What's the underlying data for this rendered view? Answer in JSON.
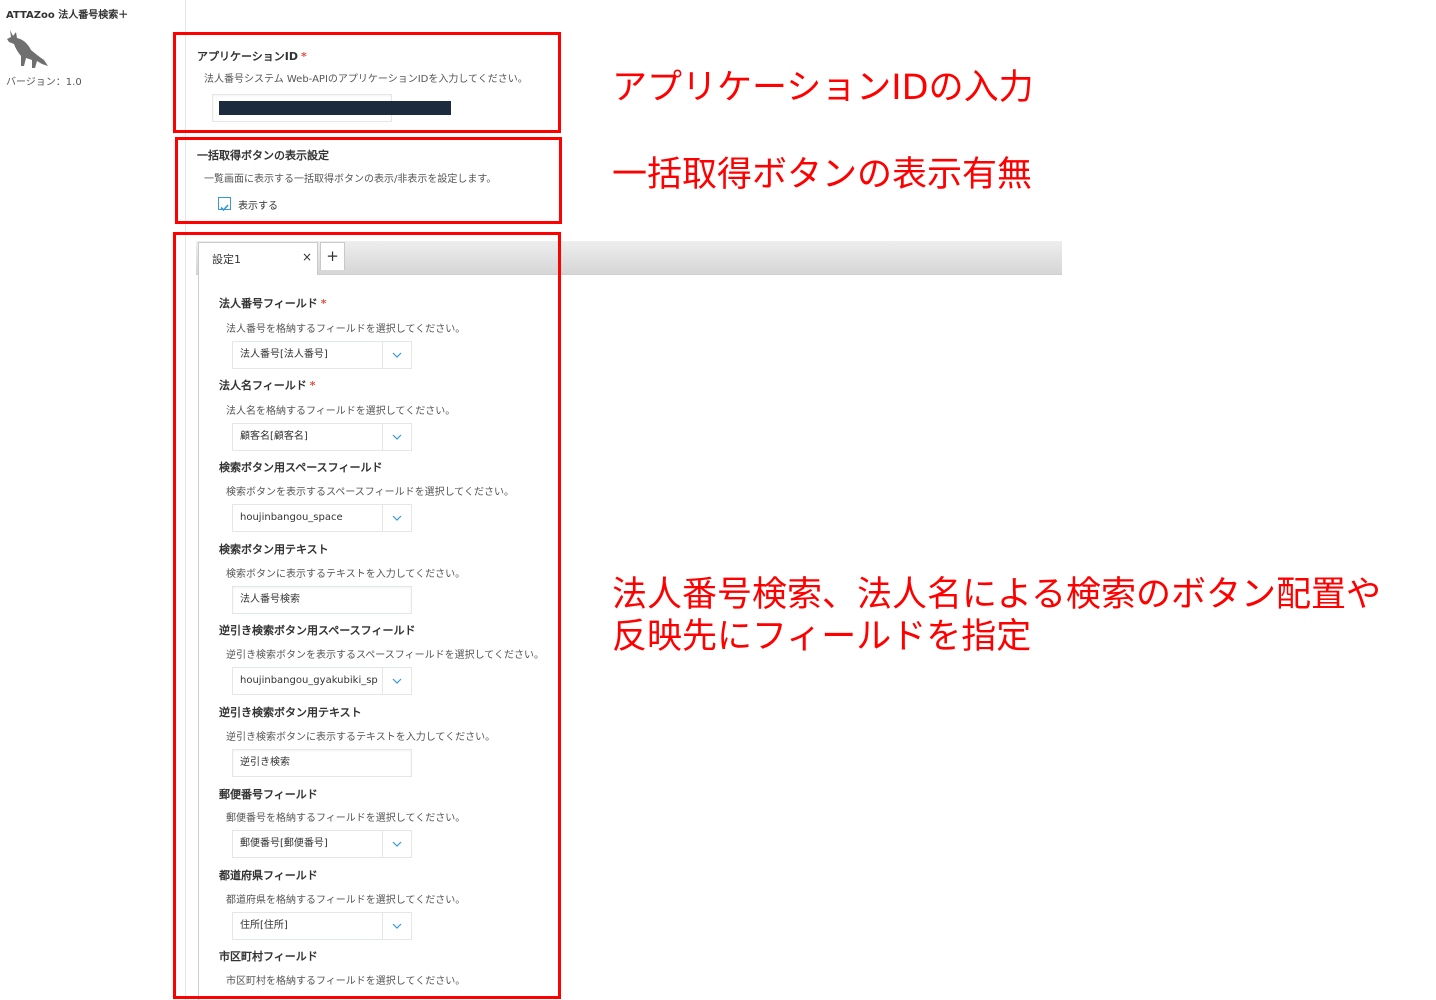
{
  "app": {
    "title": "ATTAZoo 法人番号検索＋",
    "version": "バージョン：1.0",
    "logo_icon": "wolf-icon"
  },
  "app_id": {
    "title": "アプリケーションID",
    "required_mark": "*",
    "desc": "法人番号システム Web-APIのアプリケーションIDを入力してください。",
    "value_redacted": true
  },
  "bulk": {
    "title": "一括取得ボタンの表示設定",
    "desc": "一覧画面に表示する一括取得ボタンの表示/非表示を設定します。",
    "checkbox_label": "表示する",
    "checked": true
  },
  "tabs": {
    "items": [
      {
        "label": "設定1",
        "close": "×"
      }
    ],
    "add": "+"
  },
  "settings": {
    "corp_number": {
      "title": "法人番号フィールド",
      "required_mark": "*",
      "desc": "法人番号を格納するフィールドを選択してください。",
      "value": "法人番号[法人番号]"
    },
    "corp_name": {
      "title": "法人名フィールド",
      "required_mark": "*",
      "desc": "法人名を格納するフィールドを選択してください。",
      "value": "顧客名[顧客名]"
    },
    "search_space": {
      "title": "検索ボタン用スペースフィールド",
      "desc": "検索ボタンを表示するスペースフィールドを選択してください。",
      "value": "houjinbangou_space"
    },
    "search_text": {
      "title": "検索ボタン用テキスト",
      "desc": "検索ボタンに表示するテキストを入力してください。",
      "value": "法人番号検索"
    },
    "reverse_space": {
      "title": "逆引き検索ボタン用スペースフィールド",
      "desc": "逆引き検索ボタンを表示するスペースフィールドを選択してください。",
      "value": "houjinbangou_gyakubiki_spa"
    },
    "reverse_text": {
      "title": "逆引き検索ボタン用テキスト",
      "desc": "逆引き検索ボタンに表示するテキストを入力してください。",
      "value": "逆引き検索"
    },
    "postal": {
      "title": "郵便番号フィールド",
      "desc": "郵便番号を格納するフィールドを選択してください。",
      "value": "郵便番号[郵便番号]"
    },
    "prefecture": {
      "title": "都道府県フィールド",
      "desc": "都道府県を格納するフィールドを選択してください。",
      "value": "住所[住所]"
    },
    "city": {
      "title": "市区町村フィールド",
      "desc": "市区町村を格納するフィールドを選択してください。"
    }
  },
  "annotations": {
    "app_id": "アプリケーションIDの入力",
    "bulk": "一括取得ボタンの表示有無",
    "fields_line1": "法人番号検索、法人名による検索のボタン配置や",
    "fields_line2": "反映先にフィールドを指定"
  },
  "colors": {
    "annotation_red": "#ff0000",
    "required_red": "#e74c3c",
    "checkbox_blue": "#3498db",
    "redaction": "#1c2c3e"
  }
}
